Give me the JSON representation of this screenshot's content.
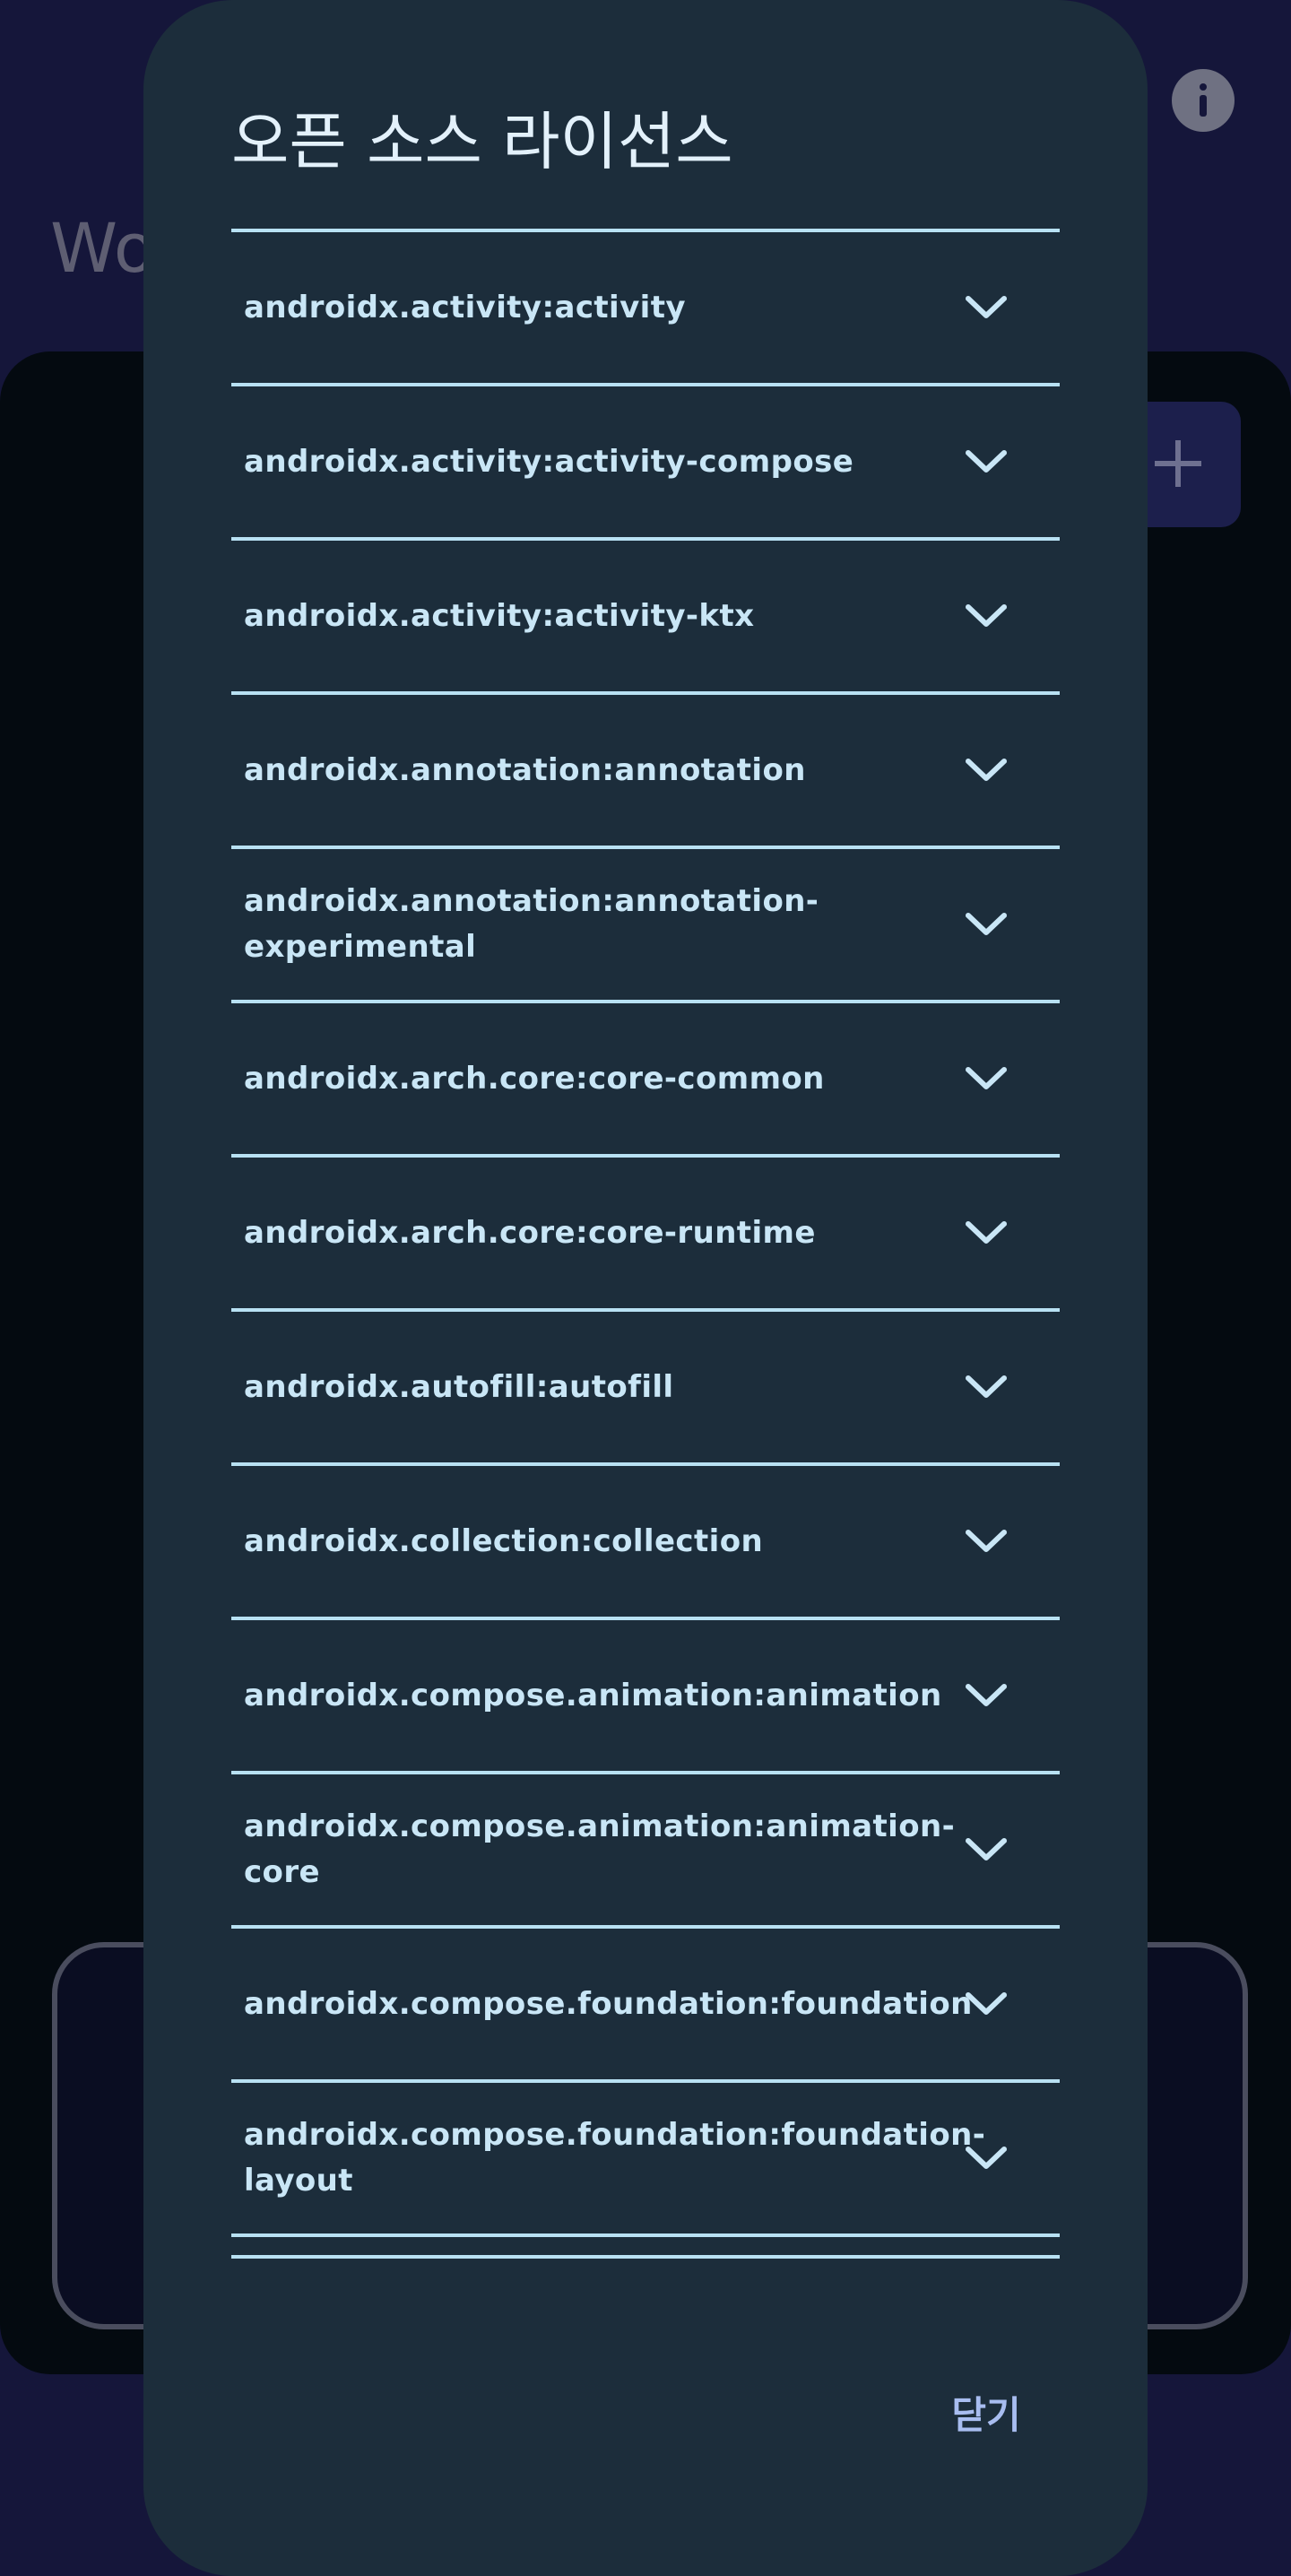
{
  "background": {
    "title": "Wo"
  },
  "dialog": {
    "title": "오픈 소스 라이선스",
    "licenses": [
      "androidx.activity:activity",
      "androidx.activity:activity-compose",
      "androidx.activity:activity-ktx",
      "androidx.annotation:annotation",
      "androidx.annotation:annotation-experimental",
      "androidx.arch.core:core-common",
      "androidx.arch.core:core-runtime",
      "androidx.autofill:autofill",
      "androidx.collection:collection",
      "androidx.compose.animation:animation",
      "androidx.compose.animation:animation-core",
      "androidx.compose.foundation:foundation",
      "androidx.compose.foundation:foundation-layout"
    ],
    "item_icon": "chevron-down-icon",
    "close_label": "닫기"
  },
  "colors": {
    "page_background": "#15163a",
    "dialog_surface": "#1c2d3b",
    "divider": "#b8e1f3",
    "item_text": "#c9e6f6",
    "title_text": "#e3f1fb",
    "accent_button": "#a8bdf0"
  }
}
